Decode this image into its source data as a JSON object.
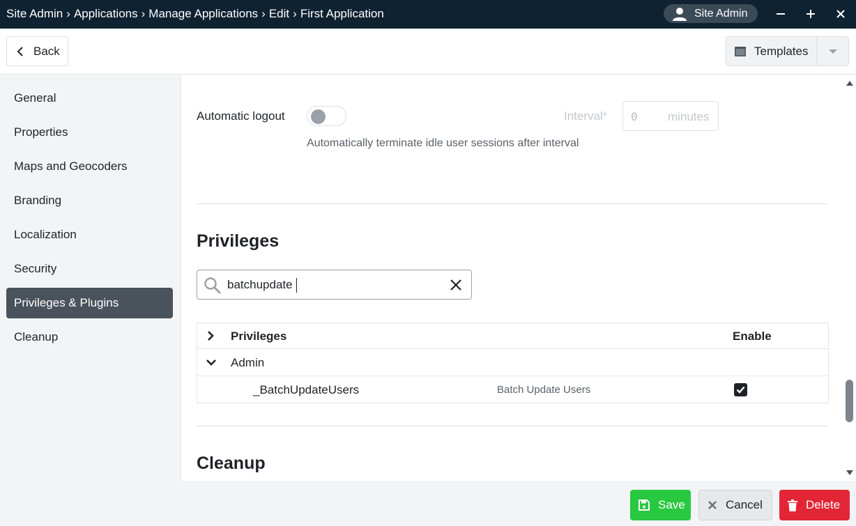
{
  "window": {
    "breadcrumb": [
      "Site Admin",
      "Applications",
      "Manage Applications",
      "Edit",
      "First Application"
    ],
    "breadcrumb_separator": "›",
    "user_label": "Site Admin",
    "minimize_icon": "minus-icon",
    "maximize_icon": "plus-icon",
    "close_icon": "close-icon"
  },
  "toolbar": {
    "back_label": "Back",
    "templates_label": "Templates"
  },
  "sidebar": {
    "items": [
      {
        "label": "General",
        "active": false
      },
      {
        "label": "Properties",
        "active": false
      },
      {
        "label": "Maps and Geocoders",
        "active": false
      },
      {
        "label": "Branding",
        "active": false
      },
      {
        "label": "Localization",
        "active": false
      },
      {
        "label": "Security",
        "active": false
      },
      {
        "label": "Privileges & Plugins",
        "active": true
      },
      {
        "label": "Cleanup",
        "active": false
      }
    ]
  },
  "security": {
    "automatic_logout_label": "Automatic logout",
    "automatic_logout_enabled": false,
    "automatic_logout_description": "Automatically terminate idle user sessions after interval",
    "interval_label": "Interval",
    "interval_required_mark": "*",
    "interval_value": "0",
    "interval_unit": "minutes"
  },
  "privileges": {
    "section_title": "Privileges",
    "search_value": "batchupdate",
    "table": {
      "header_privileges": "Privileges",
      "header_enable": "Enable",
      "group_name": "Admin",
      "rows": [
        {
          "name": "_BatchUpdateUsers",
          "description": "Batch Update Users",
          "enabled": true
        }
      ]
    }
  },
  "cleanup": {
    "section_title": "Cleanup"
  },
  "footer": {
    "save_label": "Save",
    "cancel_label": "Cancel",
    "delete_label": "Delete"
  },
  "colors": {
    "titlebar": "#0f2232",
    "active_nav": "#4a525b",
    "save": "#28c840",
    "delete": "#e32636"
  }
}
